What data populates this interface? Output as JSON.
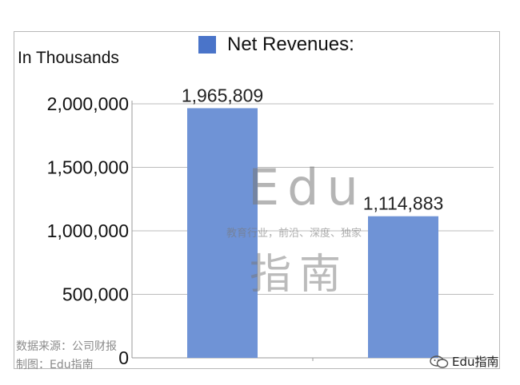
{
  "chart_data": {
    "type": "bar",
    "categories": [
      "",
      ""
    ],
    "series": [
      {
        "name": "Net Revenues:",
        "values": [
          1965809,
          1114883
        ],
        "color": "#6f93d6"
      }
    ],
    "data_labels": [
      "1,965,809",
      "1,114,883"
    ],
    "ylabel": "In Thousands",
    "ylim": [
      0,
      2000000
    ],
    "yticks": [
      0,
      500000,
      1000000,
      1500000,
      2000000
    ],
    "ytick_labels": [
      "0",
      "500,000",
      "1,000,000",
      "1,500,000",
      "2,000,000"
    ],
    "grid": true,
    "legend_position": "top-center"
  },
  "legend": {
    "label": "Net Revenues:",
    "swatch_color": "#4a74c9"
  },
  "unit_label": "In Thousands",
  "footer": {
    "source": "数据来源：公司财报",
    "made_by": "制图：Edu指南"
  },
  "watermark": {
    "edu": "Edu",
    "tagline": "教育行业，前沿、深度、独家",
    "zh": "指南"
  },
  "brand": {
    "icon": "wechat-icon",
    "name": "Edu指南"
  }
}
